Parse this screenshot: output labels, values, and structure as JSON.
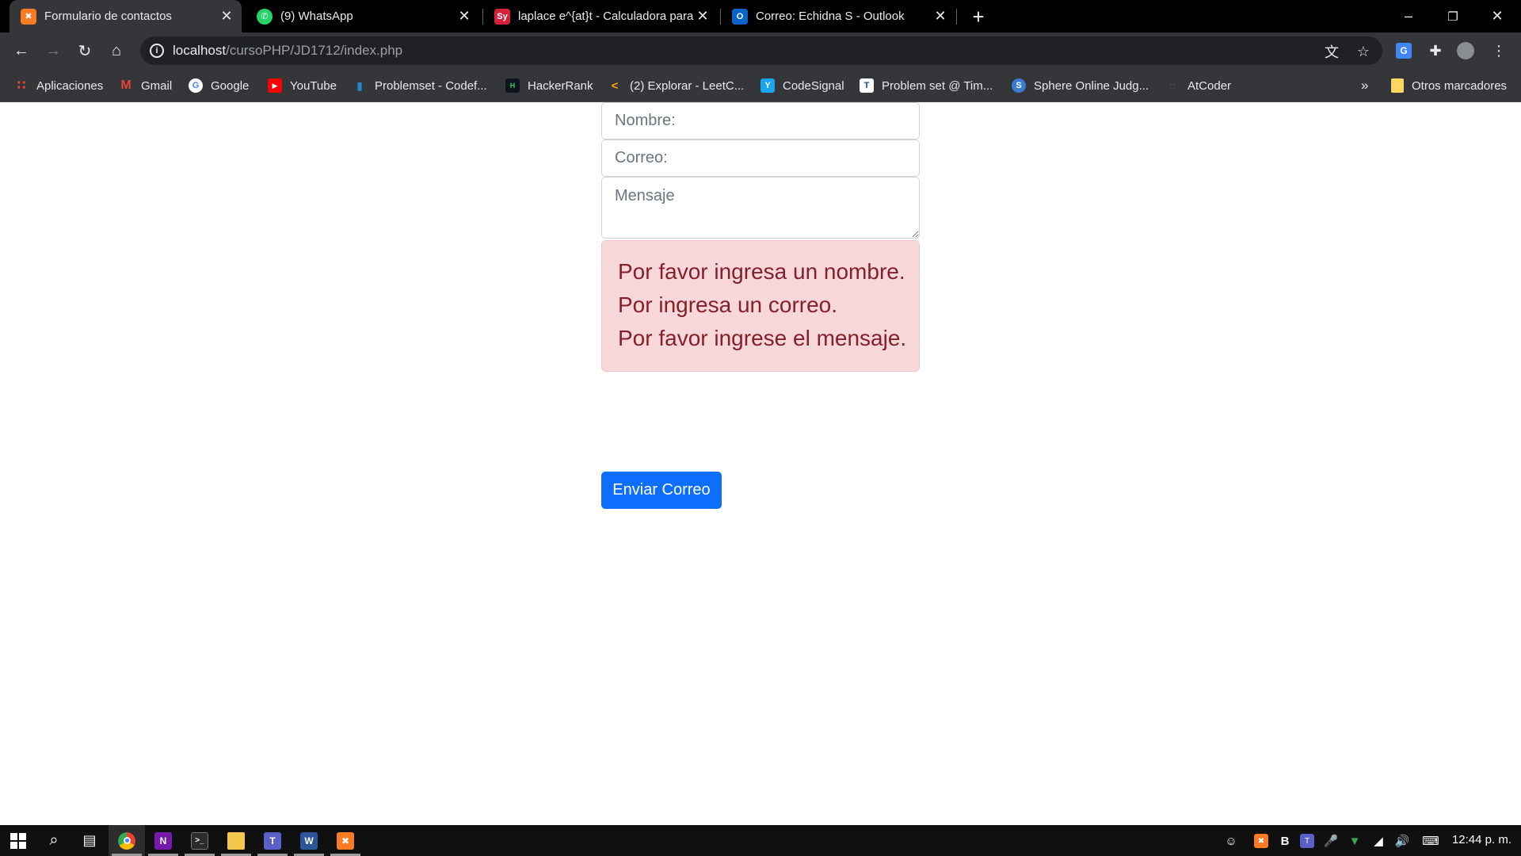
{
  "browser": {
    "tabs": [
      {
        "title": "Formulario de contactos",
        "icon": "xampp-icon",
        "active": true
      },
      {
        "title": "(9) WhatsApp",
        "icon": "whatsapp-icon",
        "active": false
      },
      {
        "title": "laplace e^{at}t - Calculadora para",
        "icon": "symbolab-icon",
        "active": false
      },
      {
        "title": "Correo: Echidna S - Outlook",
        "icon": "outlook-icon",
        "active": false
      }
    ],
    "new_tab": "+",
    "address": {
      "host": "localhost",
      "path": "/cursoPHP/JD1712/index.php"
    },
    "bookmarks": [
      "Aplicaciones",
      "Gmail",
      "Google",
      "YouTube",
      "Problemset - Codef...",
      "HackerRank",
      "(2) Explorar - LeetC...",
      "CodeSignal",
      "Problem set @ Tim...",
      "Sphere Online Judg...",
      "AtCoder"
    ],
    "more_bookmarks": "»",
    "other_bookmarks": "Otros marcadores"
  },
  "form": {
    "name_placeholder": "Nombre:",
    "email_placeholder": "Correo:",
    "message_placeholder": "Mensaje",
    "errors": [
      "Por favor ingresa un nombre.",
      "Por ingresa un correo.",
      "Por favor ingrese el mensaje."
    ],
    "submit_label": "Enviar Correo"
  },
  "taskbar": {
    "clock": "12:44 p. m."
  },
  "colors": {
    "primary_button": "#0d6efd",
    "alert_background": "#f8d7da",
    "alert_text": "#842029",
    "chrome_dark": "#35363a"
  }
}
